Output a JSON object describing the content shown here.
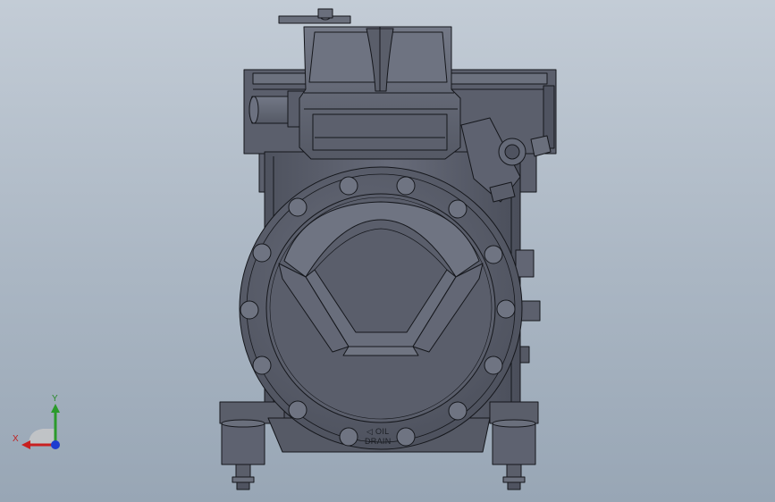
{
  "viewport": {
    "background_top": "#c3ccd6",
    "background_bottom": "#98a6b5",
    "part_color": "#5e6270",
    "edge_color": "#15171c"
  },
  "model": {
    "engraving_line1": "◁ OIL",
    "engraving_line2": "DRAIN"
  },
  "triad": {
    "y_label": "Y",
    "x_label": "X",
    "y_color": "#2b9a2b",
    "x_color": "#c82020",
    "z_color": "#1e3cd0"
  }
}
